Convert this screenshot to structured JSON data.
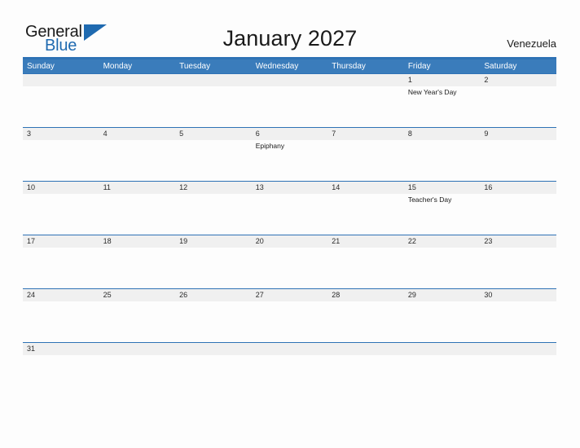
{
  "logo": {
    "word_one": "General",
    "word_two": "Blue",
    "triangle_color": "#1f6ab0"
  },
  "header": {
    "title": "January 2027",
    "region": "Venezuela",
    "accent_color": "#2e72b5",
    "header_bg": "#3a7cbb",
    "band_bg": "#f0f0f0"
  },
  "weekdays": [
    "Sunday",
    "Monday",
    "Tuesday",
    "Wednesday",
    "Thursday",
    "Friday",
    "Saturday"
  ],
  "weeks": [
    {
      "days": [
        {
          "date": "",
          "events": []
        },
        {
          "date": "",
          "events": []
        },
        {
          "date": "",
          "events": []
        },
        {
          "date": "",
          "events": []
        },
        {
          "date": "",
          "events": []
        },
        {
          "date": "1",
          "events": [
            "New Year's Day"
          ]
        },
        {
          "date": "2",
          "events": []
        }
      ]
    },
    {
      "days": [
        {
          "date": "3",
          "events": []
        },
        {
          "date": "4",
          "events": []
        },
        {
          "date": "5",
          "events": []
        },
        {
          "date": "6",
          "events": [
            "Epiphany"
          ]
        },
        {
          "date": "7",
          "events": []
        },
        {
          "date": "8",
          "events": []
        },
        {
          "date": "9",
          "events": []
        }
      ]
    },
    {
      "days": [
        {
          "date": "10",
          "events": []
        },
        {
          "date": "11",
          "events": []
        },
        {
          "date": "12",
          "events": []
        },
        {
          "date": "13",
          "events": []
        },
        {
          "date": "14",
          "events": []
        },
        {
          "date": "15",
          "events": [
            "Teacher's Day"
          ]
        },
        {
          "date": "16",
          "events": []
        }
      ]
    },
    {
      "days": [
        {
          "date": "17",
          "events": []
        },
        {
          "date": "18",
          "events": []
        },
        {
          "date": "19",
          "events": []
        },
        {
          "date": "20",
          "events": []
        },
        {
          "date": "21",
          "events": []
        },
        {
          "date": "22",
          "events": []
        },
        {
          "date": "23",
          "events": []
        }
      ]
    },
    {
      "days": [
        {
          "date": "24",
          "events": []
        },
        {
          "date": "25",
          "events": []
        },
        {
          "date": "26",
          "events": []
        },
        {
          "date": "27",
          "events": []
        },
        {
          "date": "28",
          "events": []
        },
        {
          "date": "29",
          "events": []
        },
        {
          "date": "30",
          "events": []
        }
      ]
    },
    {
      "short": true,
      "days": [
        {
          "date": "31",
          "events": []
        },
        {
          "date": "",
          "events": []
        },
        {
          "date": "",
          "events": []
        },
        {
          "date": "",
          "events": []
        },
        {
          "date": "",
          "events": []
        },
        {
          "date": "",
          "events": []
        },
        {
          "date": "",
          "events": []
        }
      ]
    }
  ]
}
